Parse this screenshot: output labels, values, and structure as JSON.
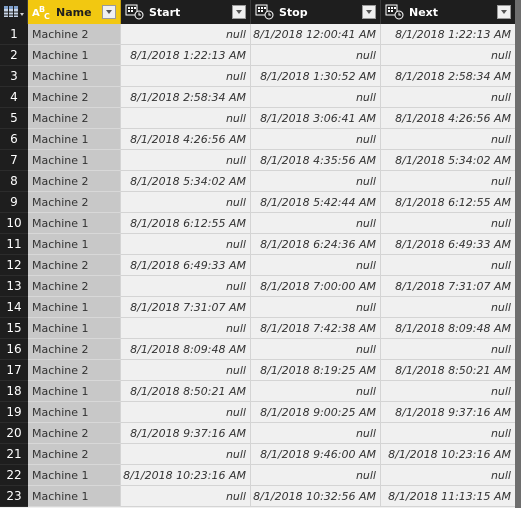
{
  "table": {
    "columns": [
      {
        "key": "name",
        "label": "Name",
        "type_icon": "text-type-icon"
      },
      {
        "key": "start",
        "label": "Start",
        "type_icon": "datetime-type-icon"
      },
      {
        "key": "stop",
        "label": "Stop",
        "type_icon": "datetime-type-icon"
      },
      {
        "key": "next",
        "label": "Next",
        "type_icon": "datetime-type-icon"
      }
    ],
    "selected_column": "Name",
    "accent_color": "#f2c811",
    "rows": [
      {
        "n": "1",
        "name": "Machine 2",
        "start": "null",
        "stop": "8/1/2018 12:00:41 AM",
        "next": "8/1/2018 1:22:13 AM"
      },
      {
        "n": "2",
        "name": "Machine 1",
        "start": "8/1/2018 1:22:13 AM",
        "stop": "null",
        "next": "null"
      },
      {
        "n": "3",
        "name": "Machine 1",
        "start": "null",
        "stop": "8/1/2018 1:30:52 AM",
        "next": "8/1/2018 2:58:34 AM"
      },
      {
        "n": "4",
        "name": "Machine 2",
        "start": "8/1/2018 2:58:34 AM",
        "stop": "null",
        "next": "null"
      },
      {
        "n": "5",
        "name": "Machine 2",
        "start": "null",
        "stop": "8/1/2018 3:06:41 AM",
        "next": "8/1/2018 4:26:56 AM"
      },
      {
        "n": "6",
        "name": "Machine 1",
        "start": "8/1/2018 4:26:56 AM",
        "stop": "null",
        "next": "null"
      },
      {
        "n": "7",
        "name": "Machine 1",
        "start": "null",
        "stop": "8/1/2018 4:35:56 AM",
        "next": "8/1/2018 5:34:02 AM"
      },
      {
        "n": "8",
        "name": "Machine 2",
        "start": "8/1/2018 5:34:02 AM",
        "stop": "null",
        "next": "null"
      },
      {
        "n": "9",
        "name": "Machine 2",
        "start": "null",
        "stop": "8/1/2018 5:42:44 AM",
        "next": "8/1/2018 6:12:55 AM"
      },
      {
        "n": "10",
        "name": "Machine 1",
        "start": "8/1/2018 6:12:55 AM",
        "stop": "null",
        "next": "null"
      },
      {
        "n": "11",
        "name": "Machine 1",
        "start": "null",
        "stop": "8/1/2018 6:24:36 AM",
        "next": "8/1/2018 6:49:33 AM"
      },
      {
        "n": "12",
        "name": "Machine 2",
        "start": "8/1/2018 6:49:33 AM",
        "stop": "null",
        "next": "null"
      },
      {
        "n": "13",
        "name": "Machine 2",
        "start": "null",
        "stop": "8/1/2018 7:00:00 AM",
        "next": "8/1/2018 7:31:07 AM"
      },
      {
        "n": "14",
        "name": "Machine 1",
        "start": "8/1/2018 7:31:07 AM",
        "stop": "null",
        "next": "null"
      },
      {
        "n": "15",
        "name": "Machine 1",
        "start": "null",
        "stop": "8/1/2018 7:42:38 AM",
        "next": "8/1/2018 8:09:48 AM"
      },
      {
        "n": "16",
        "name": "Machine 2",
        "start": "8/1/2018 8:09:48 AM",
        "stop": "null",
        "next": "null"
      },
      {
        "n": "17",
        "name": "Machine 2",
        "start": "null",
        "stop": "8/1/2018 8:19:25 AM",
        "next": "8/1/2018 8:50:21 AM"
      },
      {
        "n": "18",
        "name": "Machine 1",
        "start": "8/1/2018 8:50:21 AM",
        "stop": "null",
        "next": "null"
      },
      {
        "n": "19",
        "name": "Machine 1",
        "start": "null",
        "stop": "8/1/2018 9:00:25 AM",
        "next": "8/1/2018 9:37:16 AM"
      },
      {
        "n": "20",
        "name": "Machine 2",
        "start": "8/1/2018 9:37:16 AM",
        "stop": "null",
        "next": "null"
      },
      {
        "n": "21",
        "name": "Machine 2",
        "start": "null",
        "stop": "8/1/2018 9:46:00 AM",
        "next": "8/1/2018 10:23:16 AM"
      },
      {
        "n": "22",
        "name": "Machine 1",
        "start": "8/1/2018 10:23:16 AM",
        "stop": "null",
        "next": "null"
      },
      {
        "n": "23",
        "name": "Machine 1",
        "start": "null",
        "stop": "8/1/2018 10:32:56 AM",
        "next": "8/1/2018 11:13:15 AM"
      }
    ]
  }
}
